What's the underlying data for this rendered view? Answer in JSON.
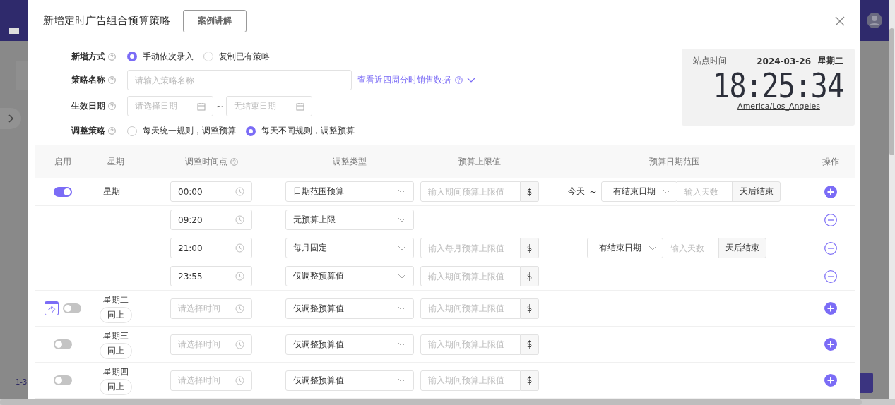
{
  "background": {
    "pagination_text": "1-3"
  },
  "modal": {
    "title": "新增定时广告组合预算策略",
    "case_button": "案例讲解"
  },
  "form": {
    "fields": [
      {
        "kind": "radio",
        "label": "新增方式",
        "options": [
          {
            "label": "手动依次录入",
            "selected": true
          },
          {
            "label": "复制已有策略",
            "selected": false
          }
        ]
      },
      {
        "kind": "text",
        "label": "策略名称",
        "placeholder": "请输入策略名称",
        "link": "查看近四周分时销售数据"
      },
      {
        "kind": "daterange",
        "label": "生效日期",
        "start_placeholder": "请选择日期",
        "separator": "~",
        "end_placeholder": "无结束日期"
      },
      {
        "kind": "radio",
        "label": "调整策略",
        "options": [
          {
            "label": "每天统一规则，调整预算",
            "selected": false
          },
          {
            "label": "每天不同规则，调整预算",
            "selected": true
          }
        ]
      }
    ]
  },
  "clock": {
    "label": "站点时间",
    "date": "2024-03-26",
    "weekday": "星期二",
    "time": "18:25:34",
    "timezone": "America/Los_Angeles"
  },
  "table": {
    "columns": [
      {
        "label": "启用",
        "help": false
      },
      {
        "label": "星期",
        "help": false
      },
      {
        "label": "调整时间点",
        "help": true
      },
      {
        "label": "调整类型",
        "help": false
      },
      {
        "label": "预算上限值",
        "help": false
      },
      {
        "label": "预算日期范围",
        "help": false
      },
      {
        "label": "操作",
        "help": false
      }
    ],
    "days": [
      {
        "day": "星期一",
        "enabled": true,
        "slots": [
          {
            "time": "00:00",
            "type": "日期范围预算",
            "budget_placeholder": "输入期间预算上限值",
            "currency": "$",
            "range": {
              "kind": "from_today",
              "start": "今天",
              "separator": "~",
              "end": "有结束日期",
              "days_placeholder": "输入天数",
              "suffix": "天后结束"
            },
            "kind": "add"
          },
          {
            "time": "09:20",
            "type": "无预算上限",
            "kind": "remove"
          },
          {
            "time": "21:00",
            "type": "每月固定",
            "budget_placeholder": "输入每月预算上限值",
            "currency": "$",
            "range": {
              "kind": "end_only",
              "end": "有结束日期",
              "days_placeholder": "输入天数",
              "suffix": "天后结束"
            },
            "kind": "remove"
          },
          {
            "time": "23:55",
            "type": "仅调整预算值",
            "budget_placeholder": "输入期间预算上限值",
            "currency": "$",
            "kind": "remove"
          }
        ]
      },
      {
        "day": "星期二",
        "enabled": false,
        "today_badge": "今",
        "copy_button": "同上",
        "slots": [
          {
            "time_placeholder": "请选择时间",
            "type": "仅调整预算值",
            "budget_placeholder": "输入期间预算上限值",
            "currency": "$",
            "kind": "add"
          }
        ]
      },
      {
        "day": "星期三",
        "enabled": false,
        "copy_button": "同上",
        "slots": [
          {
            "time_placeholder": "请选择时间",
            "type": "仅调整预算值",
            "budget_placeholder": "输入期间预算上限值",
            "currency": "$",
            "kind": "add"
          }
        ]
      },
      {
        "day": "星期四",
        "enabled": false,
        "copy_button": "同上",
        "slots": [
          {
            "time_placeholder": "请选择时间",
            "type": "仅调整预算值",
            "budget_placeholder": "输入期间预算上限值",
            "currency": "$",
            "kind": "add"
          }
        ]
      }
    ]
  }
}
